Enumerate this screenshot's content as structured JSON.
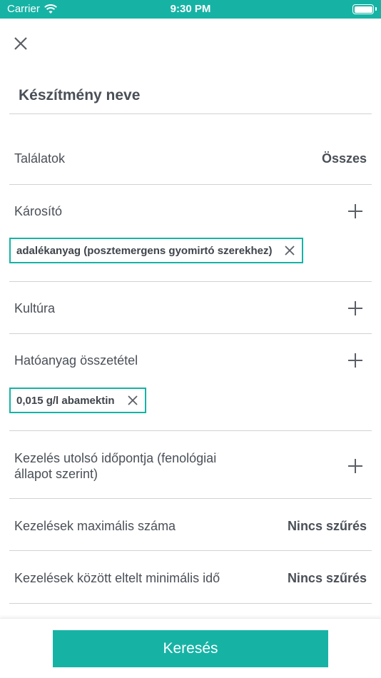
{
  "status_bar": {
    "carrier": "Carrier",
    "time": "9:30 PM"
  },
  "header": {
    "close_icon": "close-icon"
  },
  "name_field": {
    "placeholder": "Készítmény neve"
  },
  "filters": {
    "talalatok": {
      "label": "Találatok",
      "value": "Összes"
    },
    "karosito": {
      "label": "Károsító",
      "chip": "adalékanyag (posztemergens gyomirtó szerekhez)"
    },
    "kultura": {
      "label": "Kultúra"
    },
    "hatoanyag": {
      "label": "Hatóanyag összetétel",
      "chip": "0,015 g/l abamektin"
    },
    "kezeles_idopont": {
      "label_line1": "Kezelés utolsó időpontja (fenológiai",
      "label_line2": "állapot szerint)"
    },
    "kezelesek_max": {
      "label": "Kezelések maximális száma",
      "value": "Nincs szűrés"
    },
    "kezelesek_min_ido": {
      "label": "Kezelések között eltelt minimális idő",
      "value": "Nincs szűrés"
    }
  },
  "actions": {
    "search_label": "Keresés"
  },
  "colors": {
    "accent": "#16b3a5",
    "text": "#4a4f57",
    "divider": "#cfd2d6"
  }
}
